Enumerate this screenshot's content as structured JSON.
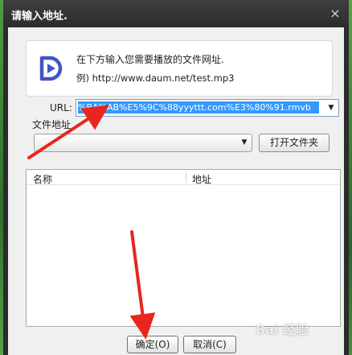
{
  "window": {
    "title": "请输入地址.",
    "close_symbol": "×"
  },
  "info": {
    "line1": "在下方输入您需要播放的文件网址.",
    "line2": "例) http://www.daum.net/test.mp3",
    "icon": "play-logo-icon",
    "icon_color": "#3f56c8"
  },
  "url": {
    "label": "URL:",
    "value": "%BA%AB%E5%9C%88yyyttt.com%E3%80%91.rmvb",
    "selection_color": "#3399ff"
  },
  "file": {
    "label": "文件地址",
    "value": "",
    "open_button": "打开文件夹"
  },
  "list": {
    "columns": [
      "名称",
      "地址"
    ],
    "rows": []
  },
  "buttons": {
    "ok": "确定(O)",
    "cancel": "取消(C)"
  },
  "annotation": {
    "arrow_color": "#e8261d",
    "watermark": "Bai 经验"
  }
}
